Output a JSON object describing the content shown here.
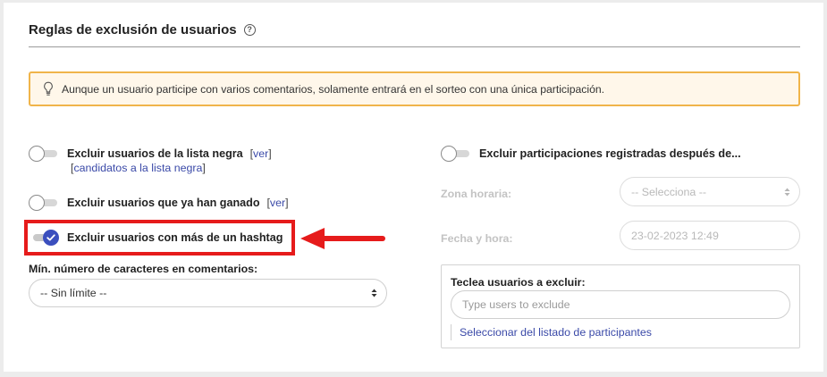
{
  "section": {
    "title": "Reglas de exclusión de usuarios",
    "help_icon": "question-circle-icon"
  },
  "notice": {
    "icon": "lightbulb-icon",
    "text": "Aunque un usuario participe con varios comentarios, solamente entrará en el sorteo con una única participación."
  },
  "left": {
    "blacklist": {
      "label": "Excluir usuarios de la lista negra",
      "link_ver": "ver",
      "link_candidates": "candidatos a la lista negra",
      "enabled": false
    },
    "winners": {
      "label": "Excluir usuarios que ya han ganado",
      "link_ver": "ver",
      "enabled": false
    },
    "hashtag": {
      "label": "Excluir usuarios con más de un hashtag",
      "enabled": true
    },
    "min_chars": {
      "label": "Mín. número de caracteres en comentarios:",
      "selected": "-- Sin límite --"
    }
  },
  "right": {
    "after_date": {
      "label": "Excluir participaciones registradas después de...",
      "enabled": false
    },
    "timezone": {
      "label": "Zona horaria:",
      "selected": "-- Selecciona --"
    },
    "datetime": {
      "label": "Fecha y hora:",
      "value": "23-02-2023 12:49"
    },
    "exclude_users": {
      "label": "Teclea usuarios a excluir:",
      "placeholder": "Type users to exclude",
      "list_link": "Seleccionar del listado de participantes"
    }
  },
  "colors": {
    "accent": "#3b4fbe",
    "notice_border": "#f0b44a",
    "notice_bg": "#fff7ea",
    "highlight": "#e61b1b",
    "link": "#3b4aa8"
  }
}
